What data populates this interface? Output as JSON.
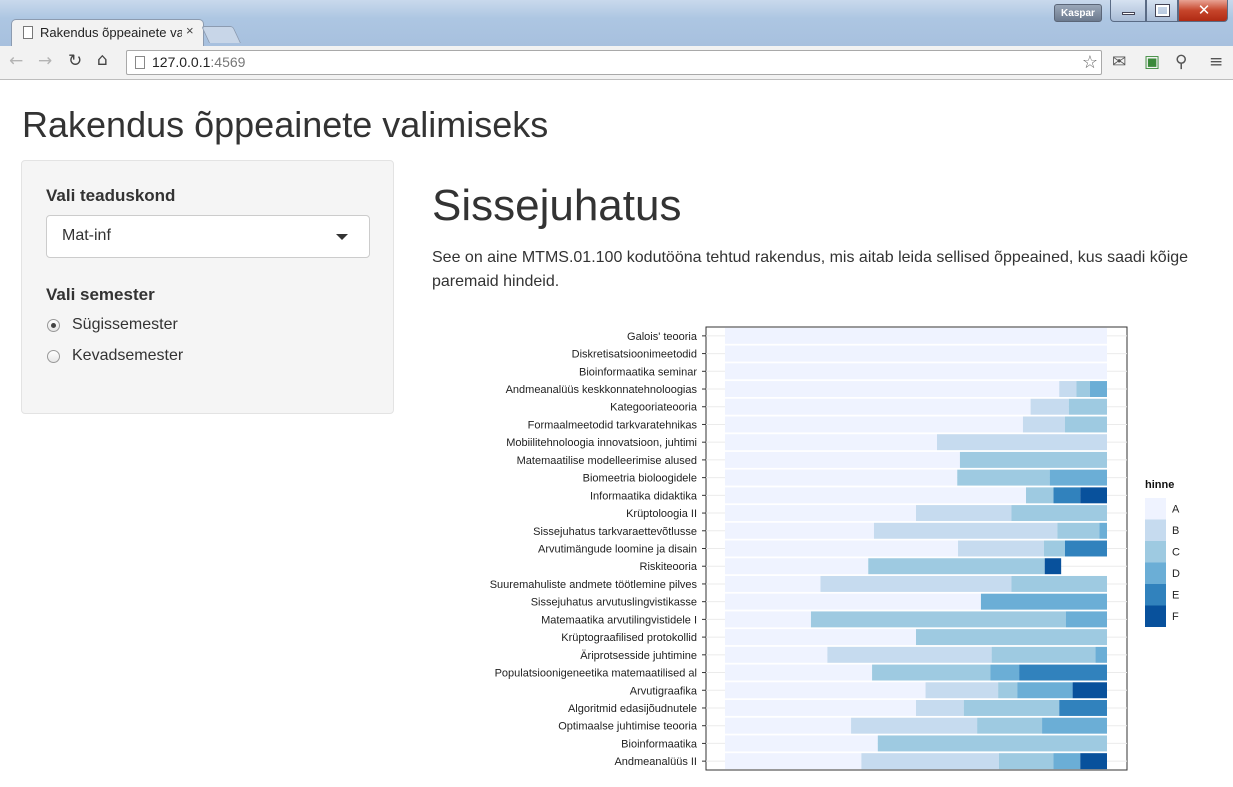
{
  "browser": {
    "tab_title": "Rakendus õppeainete valimiseks",
    "tab_close": "×",
    "url_host": "127.0.0.1",
    "url_port": ":4569",
    "user": "Kaspar",
    "icons": [
      "back-arrow-icon",
      "forward-arrow-icon",
      "reload-icon",
      "home-icon",
      "bookmark-star-icon",
      "mail-icon",
      "extension-icon",
      "key-icon",
      "menu-icon"
    ]
  },
  "app": {
    "title": "Rakendus õppeainete valimiseks"
  },
  "sidebar": {
    "faculty_label": "Vali teaduskond",
    "faculty_value": "Mat-inf",
    "semester_label": "Vali semester",
    "semesters": [
      {
        "label": "Sügissemester",
        "selected": true
      },
      {
        "label": "Kevadsemester",
        "selected": false
      }
    ]
  },
  "main": {
    "heading": "Sissejuhatus",
    "intro": "See on aine MTMS.01.100 kodutööna tehtud rakendus, mis aitab leida sellised õppeained, kus saadi kõige paremaid hindeid."
  },
  "chart_data": {
    "type": "bar",
    "stacked": true,
    "orientation": "horizontal",
    "normalized": true,
    "xlim": [
      0,
      1
    ],
    "legend_title": "hinne",
    "legend_position": "right",
    "colors": {
      "A": "#eff3ff",
      "B": "#c6dbef",
      "C": "#9ecae1",
      "D": "#6baed6",
      "E": "#3182bd",
      "F": "#08519c"
    },
    "categories": [
      "Galois' teooria",
      "Diskretisatsioonimeetodid",
      "Bioinformaatika seminar",
      "Andmeanalüüs keskkonnatehnoloogias",
      "Kategooriateooria",
      "Formaalmeetodid tarkvaratehnikas",
      "Mobiilitehnoloogia innovatsioon, juhtimi",
      "Matemaatilise modelleerimise alused",
      "Biomeetria bioloogidele",
      "Informaatika didaktika",
      "Krüptoloogia II",
      "Sissejuhatus tarkvaraettevõtlusse",
      "Arvutimängude loomine ja disain",
      "Riskiteooria",
      "Suuremahuliste andmete töötlemine pilves",
      "Sissejuhatus arvutuslingvistikasse",
      "Matemaatika arvutilingvistidele I",
      "Krüptograafilised protokollid",
      "Äriprotsesside juhtimine",
      "Populatsioonigeneetika matemaatilised al",
      "Arvutigraafika",
      "Algoritmid edasijõudnutele",
      "Optimaalse juhtimise teooria",
      "Bioinformaatika",
      "Andmeanalüüs II"
    ],
    "series": [
      {
        "name": "A",
        "values": [
          1.0,
          1.0,
          1.0,
          0.875,
          0.8,
          0.78,
          0.555,
          0.615,
          0.608,
          0.788,
          0.5,
          0.39,
          0.61,
          0.375,
          0.25,
          0.67,
          0.225,
          0.5,
          0.268,
          0.385,
          0.525,
          0.5,
          0.33,
          0.4,
          0.357
        ]
      },
      {
        "name": "B",
        "values": [
          0,
          0,
          0,
          0.045,
          0.1,
          0.11,
          0.445,
          0,
          0,
          0,
          0.25,
          0.48,
          0.225,
          0,
          0.5,
          0,
          0,
          0,
          0.43,
          0,
          0.19,
          0.125,
          0.33,
          0,
          0.36
        ]
      },
      {
        "name": "C",
        "values": [
          0,
          0,
          0,
          0.035,
          0.1,
          0.11,
          0,
          0.385,
          0.242,
          0.072,
          0.25,
          0.11,
          0.055,
          0.462,
          0.25,
          0,
          0.667,
          0.5,
          0.272,
          0.31,
          0.05,
          0.25,
          0.17,
          0.6,
          0.143
        ]
      },
      {
        "name": "D",
        "values": [
          0,
          0,
          0,
          0.045,
          0,
          0,
          0,
          0,
          0.15,
          0,
          0,
          0.02,
          0,
          0,
          0,
          0.33,
          0.108,
          0,
          0.03,
          0.075,
          0.145,
          0,
          0.17,
          0,
          0.07
        ]
      },
      {
        "name": "E",
        "values": [
          0,
          0,
          0,
          0,
          0,
          0,
          0,
          0,
          0,
          0.07,
          0,
          0,
          0.11,
          0,
          0,
          0,
          0,
          0,
          0,
          0.23,
          0,
          0.125,
          0,
          0,
          0
        ]
      },
      {
        "name": "F",
        "values": [
          0,
          0,
          0,
          0,
          0,
          0,
          0,
          0,
          0,
          0.07,
          0,
          0,
          0,
          0.043,
          0,
          0,
          0,
          0,
          0,
          0,
          0.09,
          0,
          0,
          0,
          0.07
        ]
      }
    ]
  }
}
